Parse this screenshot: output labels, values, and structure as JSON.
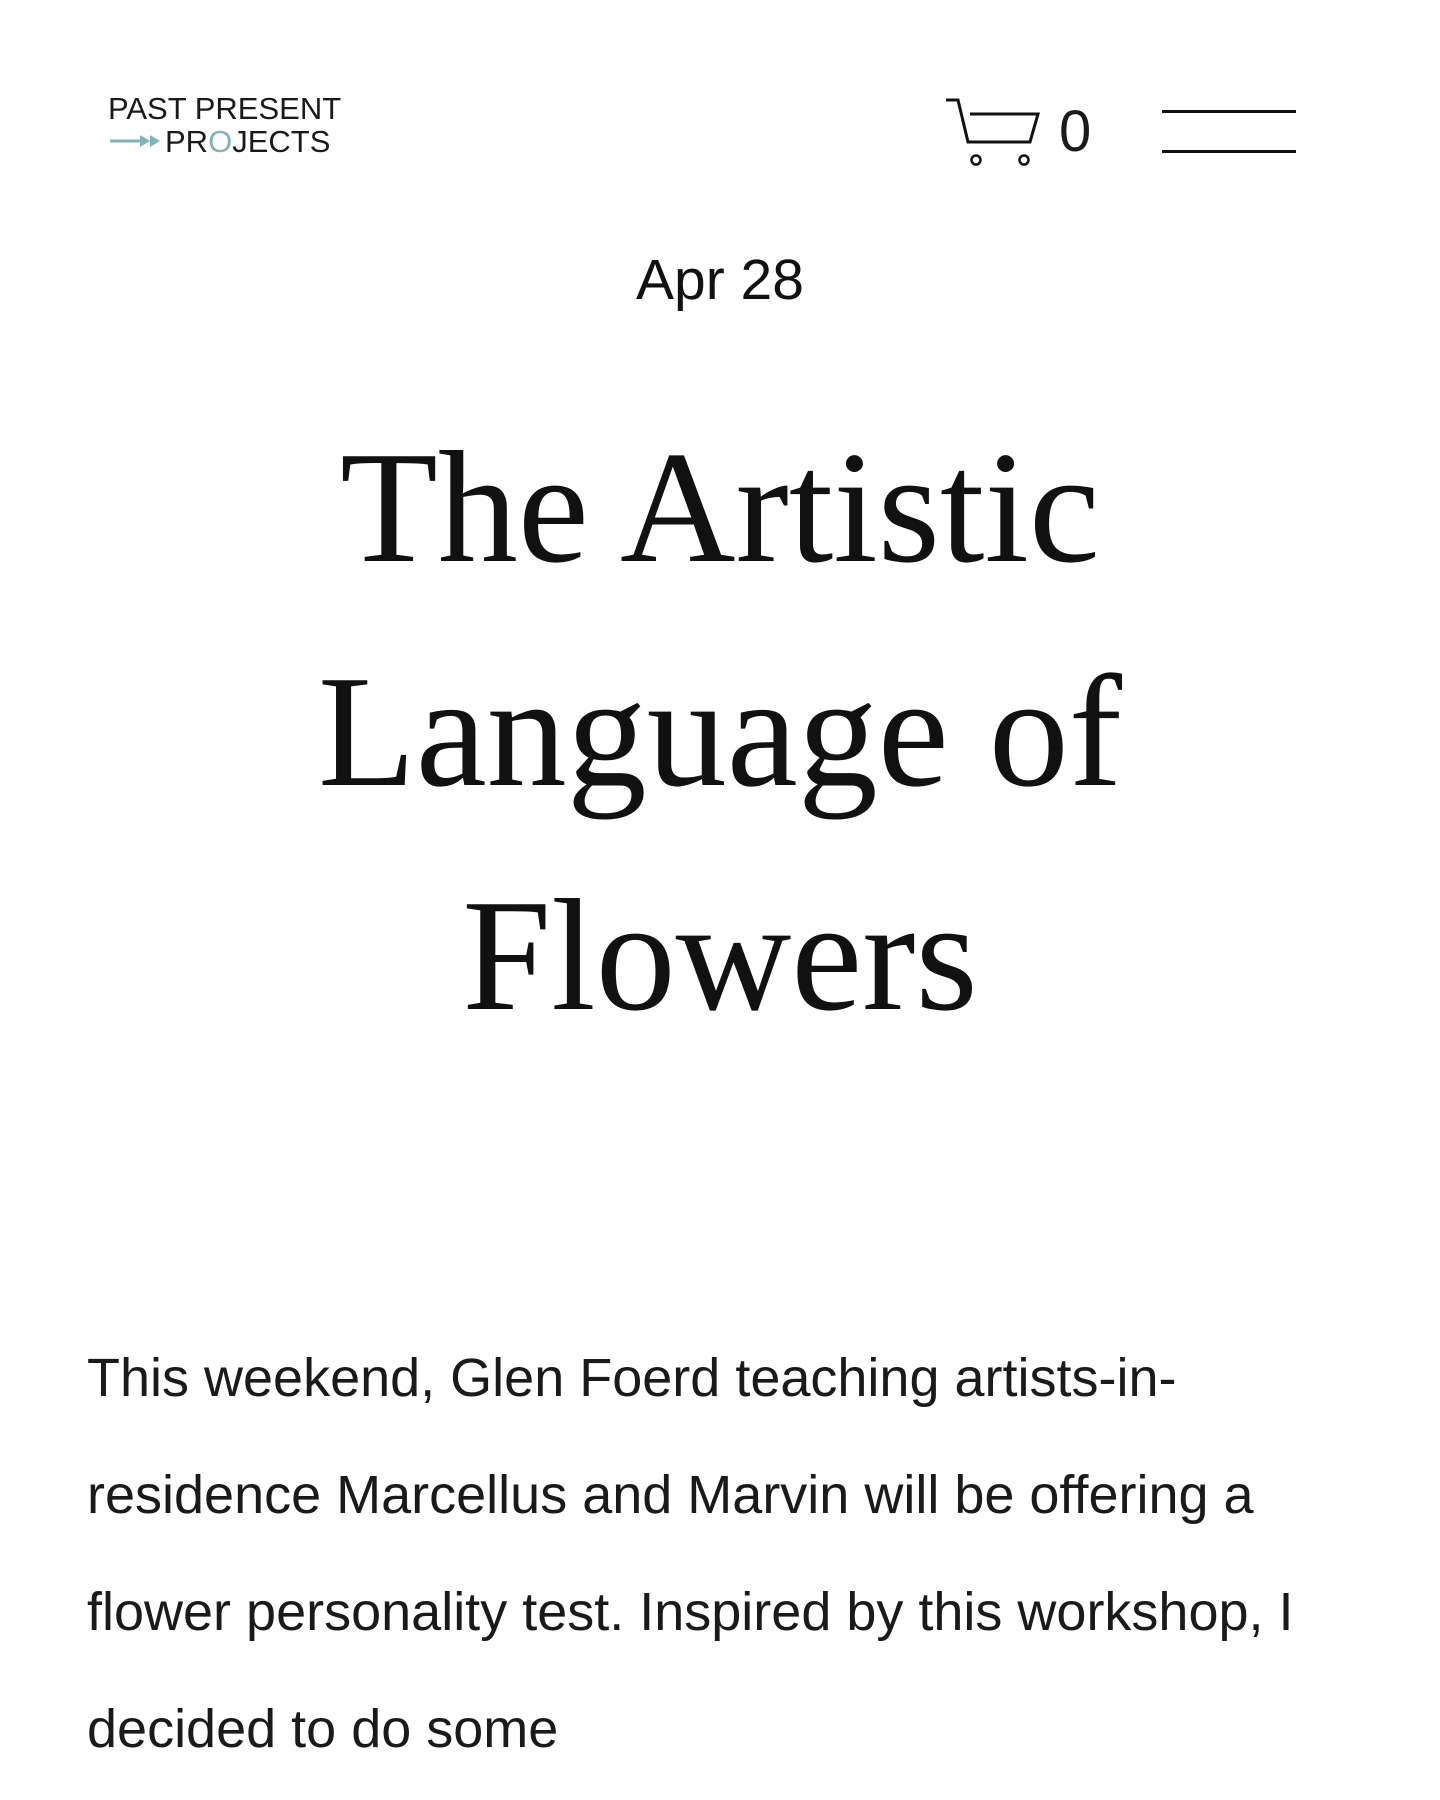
{
  "header": {
    "logo": {
      "line1": "PAST PRESENT",
      "line2_prefix": "PR",
      "line2_accent": "O",
      "line2_suffix": "JECTS",
      "accent_color": "#7fb3b8"
    },
    "cart": {
      "icon": "cart-icon",
      "count": "0"
    },
    "menu": {
      "icon": "hamburger-menu-icon"
    }
  },
  "post": {
    "date": "Apr 28",
    "title": "The Artistic Language of Flowers",
    "body": "This weekend, Glen Foerd teaching artists-in-residence Marcellus and Marvin will be offering a flower personality test. Inspired by this workshop, I decided to do some"
  },
  "colors": {
    "text": "#111111",
    "background": "#ffffff",
    "accent": "#7fb3b8"
  }
}
